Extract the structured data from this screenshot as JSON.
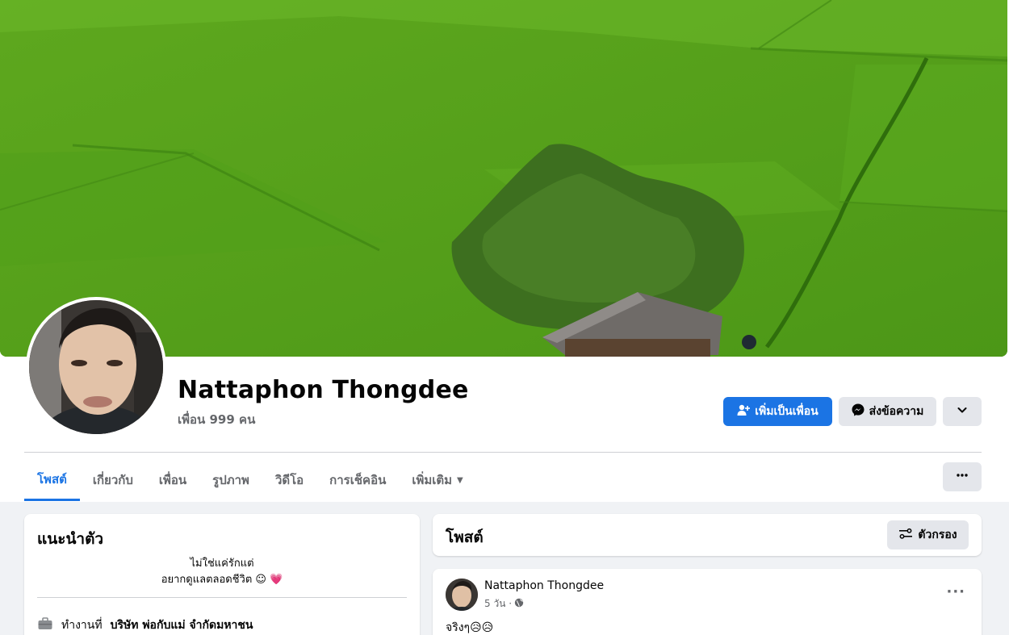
{
  "profile": {
    "name": "Nattaphon Thongdee",
    "friends": "เพื่อน 999 คน"
  },
  "actions": {
    "add_friend": "เพิ่มเป็นเพื่อน",
    "message": "ส่งข้อความ"
  },
  "tabs": [
    {
      "label": "โพสต์",
      "active": true
    },
    {
      "label": "เกี่ยวกับ",
      "active": false
    },
    {
      "label": "เพื่อน",
      "active": false
    },
    {
      "label": "รูปภาพ",
      "active": false
    },
    {
      "label": "วิดีโอ",
      "active": false
    },
    {
      "label": "การเช็คอิน",
      "active": false
    },
    {
      "label": "เพิ่มเติม",
      "active": false
    }
  ],
  "intro": {
    "title": "แนะนำตัว",
    "bio_line1": "ไม่ใช่แค่รักแต่",
    "bio_line2": "อยากดูแลตลอดชีวิต ☺ 💗",
    "work_prefix": "ทำงานที่",
    "work_place": "บริษัท พ่อกับแม่ จำกัดมหาชน"
  },
  "posts": {
    "title": "โพสต์",
    "filter_label": "ตัวกรอง"
  },
  "post": {
    "author": "Nattaphon Thongdee",
    "time": "5 วัน ·",
    "text": "จริงๆ😥😥"
  },
  "colors": {
    "accent": "#1b74e4",
    "secondary_button": "#e4e6eb",
    "muted_text": "#65676b",
    "page_bg": "#f0f2f5"
  },
  "icons": {
    "add_friend": "person-plus-icon",
    "message": "messenger-icon",
    "chevron": "chevron-down-icon",
    "more": "more-dots-icon",
    "filter": "filter-sliders-icon",
    "work": "briefcase-icon",
    "globe": "globe-icon"
  }
}
